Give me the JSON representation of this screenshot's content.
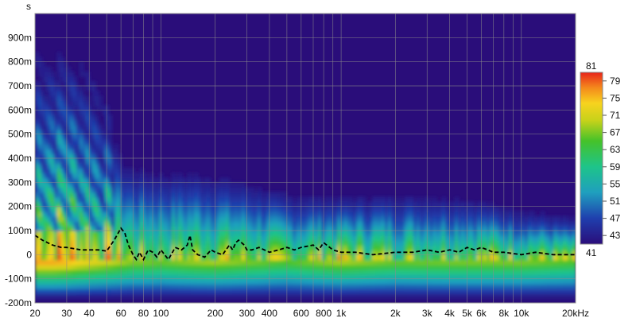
{
  "chart_data": {
    "type": "heatmap",
    "title": "",
    "xlabel": "",
    "ylabel": "s",
    "x_scale": "log",
    "x_unit_suffix": "kHz",
    "xlim": [
      20,
      20000
    ],
    "ylim": [
      -0.2,
      1.0
    ],
    "grid": true,
    "x_ticks": [
      {
        "value": 20,
        "label": "20"
      },
      {
        "value": 30,
        "label": "30"
      },
      {
        "value": 40,
        "label": "40"
      },
      {
        "value": 60,
        "label": "60"
      },
      {
        "value": 80,
        "label": "80"
      },
      {
        "value": 100,
        "label": "100"
      },
      {
        "value": 200,
        "label": "200"
      },
      {
        "value": 300,
        "label": "300"
      },
      {
        "value": 400,
        "label": "400"
      },
      {
        "value": 600,
        "label": "600"
      },
      {
        "value": 800,
        "label": "800"
      },
      {
        "value": 1000,
        "label": "1k"
      },
      {
        "value": 2000,
        "label": "2k"
      },
      {
        "value": 3000,
        "label": "3k"
      },
      {
        "value": 4000,
        "label": "4k"
      },
      {
        "value": 5000,
        "label": "5k"
      },
      {
        "value": 6000,
        "label": "6k"
      },
      {
        "value": 8000,
        "label": "8k"
      },
      {
        "value": 10000,
        "label": "10k"
      },
      {
        "value": 20000,
        "label": "20kHz"
      }
    ],
    "y_ticks": [
      {
        "value": 0.9,
        "label": "900m"
      },
      {
        "value": 0.8,
        "label": "800m"
      },
      {
        "value": 0.7,
        "label": "700m"
      },
      {
        "value": 0.6,
        "label": "600m"
      },
      {
        "value": 0.5,
        "label": "500m"
      },
      {
        "value": 0.4,
        "label": "400m"
      },
      {
        "value": 0.3,
        "label": "300m"
      },
      {
        "value": 0.2,
        "label": "200m"
      },
      {
        "value": 0.1,
        "label": "100m"
      },
      {
        "value": 0,
        "label": "0"
      },
      {
        "value": -0.1,
        "label": "-100m"
      },
      {
        "value": -0.2,
        "label": "-200m"
      }
    ],
    "colorbar": {
      "min": 41,
      "max": 81,
      "min_label": "41",
      "max_label": "81",
      "ticks": [
        {
          "value": 79,
          "label": "79"
        },
        {
          "value": 75,
          "label": "75"
        },
        {
          "value": 71,
          "label": "71"
        },
        {
          "value": 67,
          "label": "67"
        },
        {
          "value": 63,
          "label": "63"
        },
        {
          "value": 59,
          "label": "59"
        },
        {
          "value": 55,
          "label": "55"
        },
        {
          "value": 51,
          "label": "51"
        },
        {
          "value": 47,
          "label": "47"
        },
        {
          "value": 43,
          "label": "43"
        }
      ]
    },
    "colors": {
      "background": "#2a0d7a",
      "grid": "#8c8c8c",
      "peak_line": "#000000",
      "low": "#2a0d7a",
      "high": "#e8241a"
    },
    "energy_profile": {
      "description_free": true,
      "freq": [
        20,
        25,
        30,
        35,
        40,
        50,
        60,
        70,
        80,
        100,
        150,
        200,
        300,
        500,
        1000,
        2000,
        5000,
        10000,
        20000
      ],
      "decay_top_s": [
        0.98,
        0.98,
        0.98,
        0.95,
        0.9,
        0.75,
        0.45,
        0.42,
        0.42,
        0.4,
        0.4,
        0.38,
        0.35,
        0.3,
        0.28,
        0.3,
        0.28,
        0.22,
        0.18
      ],
      "level_db": [
        80,
        80,
        79,
        77,
        76,
        74,
        72,
        70,
        70,
        69,
        71,
        72,
        70,
        68,
        72,
        69,
        70,
        70,
        68
      ]
    },
    "peak_curve": {
      "freq": [
        20,
        22,
        25,
        28,
        30,
        33,
        36,
        40,
        45,
        50,
        55,
        60,
        63,
        66,
        70,
        73,
        76,
        80,
        85,
        90,
        95,
        100,
        110,
        120,
        130,
        140,
        145,
        150,
        160,
        175,
        190,
        200,
        220,
        240,
        250,
        260,
        270,
        290,
        300,
        320,
        350,
        400,
        450,
        500,
        550,
        600,
        700,
        750,
        800,
        900,
        1000,
        1200,
        1500,
        2000,
        2500,
        3000,
        3500,
        4000,
        4500,
        5000,
        5500,
        6000,
        7000,
        8000,
        10000,
        12000,
        15000,
        18000,
        20000
      ],
      "time_s": [
        0.08,
        0.06,
        0.04,
        0.03,
        0.03,
        0.025,
        0.02,
        0.02,
        0.02,
        0.015,
        0.06,
        0.11,
        0.09,
        0.04,
        0.0,
        -0.02,
        0.01,
        -0.02,
        0.02,
        0.01,
        -0.01,
        0.02,
        -0.02,
        0.03,
        0.02,
        0.04,
        0.08,
        0.02,
        0.0,
        -0.01,
        0.02,
        0.01,
        0.0,
        0.04,
        0.02,
        0.05,
        0.06,
        0.04,
        0.02,
        0.02,
        0.03,
        0.01,
        0.02,
        0.03,
        0.02,
        0.03,
        0.04,
        0.02,
        0.05,
        0.02,
        0.01,
        0.01,
        0.0,
        0.01,
        0.01,
        0.02,
        0.01,
        0.02,
        0.01,
        0.03,
        0.02,
        0.03,
        0.01,
        0.01,
        0.0,
        0.01,
        0.0,
        0.0,
        0.0
      ]
    }
  }
}
